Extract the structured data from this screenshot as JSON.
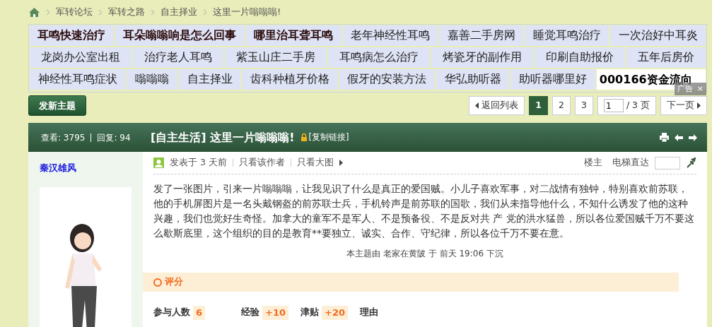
{
  "breadcrumb": [
    "军转论坛",
    "军转之路",
    "自主择业",
    "这里一片嗡嗡嗡!"
  ],
  "tag_rows": [
    [
      {
        "text": "耳鸣快速治疗",
        "kind": "bold"
      },
      {
        "text": "耳朵嗡嗡响是怎么回事",
        "kind": "bold"
      },
      {
        "text": "哪里治耳聋耳鸣",
        "kind": "bold"
      },
      {
        "text": "老年神经性耳鸣",
        "kind": "normal"
      },
      {
        "text": "嘉善二手房网",
        "kind": "normal"
      },
      {
        "text": "睡觉耳鸣治疗",
        "kind": "normal"
      },
      {
        "text": "一次治好中耳炎",
        "kind": "normal"
      }
    ],
    [
      {
        "text": "龙岗办公室出租",
        "kind": "normal"
      },
      {
        "text": "治疗老人耳鸣",
        "kind": "normal"
      },
      {
        "text": "紫玉山庄二手房",
        "kind": "normal"
      },
      {
        "text": "耳鸣病怎么治疗",
        "kind": "normal"
      },
      {
        "text": "烤瓷牙的副作用",
        "kind": "normal"
      },
      {
        "text": "印刷自助报价",
        "kind": "normal"
      },
      {
        "text": "五年后房价",
        "kind": "normal"
      }
    ],
    [
      {
        "text": "神经性耳鸣症状",
        "kind": "normal"
      },
      {
        "text": "嗡嗡嗡",
        "kind": "normal"
      },
      {
        "text": "自主择业",
        "kind": "normal"
      },
      {
        "text": "齿科种植牙价格",
        "kind": "normal"
      },
      {
        "text": "假牙的安装方法",
        "kind": "normal"
      },
      {
        "text": "华弘助听器",
        "kind": "normal"
      },
      {
        "text": "助听器哪里好",
        "kind": "normal"
      },
      {
        "text": "000166资金流向",
        "kind": "ad"
      }
    ]
  ],
  "ad_badge": {
    "label": "广告",
    "close": "×"
  },
  "new_thread_button": "发新主题",
  "pagination": {
    "back": "返回列表",
    "pages": [
      {
        "label": "1",
        "selected": true
      },
      {
        "label": "2",
        "selected": false
      },
      {
        "label": "3",
        "selected": false
      }
    ],
    "page_input": "1",
    "total": "/ 3 页",
    "next": "下一页"
  },
  "thread": {
    "views": "查看: 3795",
    "replies": "回复: 94",
    "category": "[自主生活]",
    "title": "这里一片嗡嗡嗡!",
    "copy_link": "[复制链接]"
  },
  "author": {
    "name": "秦汉雄风"
  },
  "post": {
    "posted": "发表于 3 天前",
    "only_author": "只看该作者",
    "only_big": "只看大图",
    "floor": "楼主",
    "jump_label": "电梯直达",
    "body": "发了一张图片，引来一片嗡嗡嗡，让我见识了什么是真正的爱国贼。小儿子喜欢军事，对二战情有独钟，特别喜欢前苏联，他的手机屏图片是一名头戴钢盔的前苏联士兵，手机铃声是前苏联的国歌，我们从未指导他什么，不知什么诱发了他的这种兴趣，我们也觉好生奇怪。加拿大的童军不是军人、不是预备役、不是反对共 产 党的洪水猛兽，所以各位爱国贼千万不要这么歇斯底里，这个组织的目的是教育**要独立、诚实、合作、守纪律，所以各位千万不要在意。",
    "moderation": "本主题由 老家在黄陂 于 前天 19:06 下沉"
  },
  "rating": {
    "title": "评分",
    "participants_label": "参与人数",
    "participants": "6",
    "exp_label": "经验",
    "exp": "+10",
    "bonus_label": "津贴",
    "bonus": "+20",
    "reason_label": "理由"
  }
}
